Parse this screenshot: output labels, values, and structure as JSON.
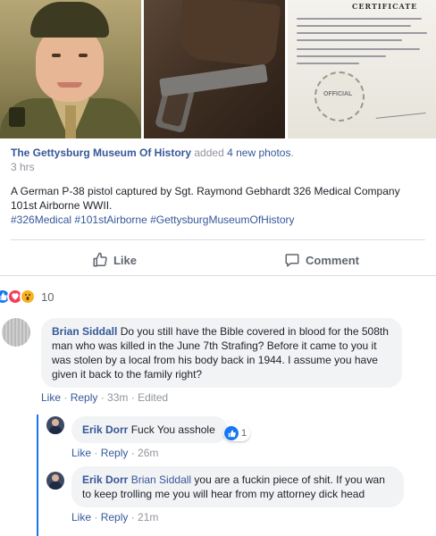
{
  "photos": {
    "certificate_title": "CERTIFICATE",
    "seal_label": "OFFICIAL"
  },
  "post": {
    "page_name": "The Gettysburg Museum Of History",
    "action_text": "added",
    "photo_count": "4 new photos",
    "period": ".",
    "time": "3 hrs",
    "body": "A German P-38 pistol captured by Sgt. Raymond Gebhardt 326 Medical Company 101st Airborne WWII.",
    "hashtags": "#326Medical #101stAirborne #GettysburgMuseumOfHistory"
  },
  "actions": {
    "like": "Like",
    "comment": "Comment"
  },
  "reactions": {
    "count": "10",
    "types": [
      "like",
      "love",
      "wow"
    ]
  },
  "comments": [
    {
      "author": "Brian Siddall",
      "text": "Do you still have the Bible covered in blood for the 508th man who was killed in the June 7th Strafing? Before it came to you it was stolen by a local from his body back in 1944. I assume you have given it back to the family right?",
      "like": "Like",
      "reply": "Reply",
      "time": "33m",
      "edited": "Edited"
    },
    {
      "author": "Erik Dorr",
      "text": "Fuck You asshole",
      "reaction_count": "1",
      "like": "Like",
      "reply": "Reply",
      "time": "26m"
    },
    {
      "author": "Erik Dorr",
      "mention": "Brian Siddall",
      "text": "you are a fuckin piece of shit. If you wan to keep trolling me you will hear from my attorney dick head",
      "like": "Like",
      "reply": "Reply",
      "time": "21m"
    }
  ],
  "colors": {
    "link": "#365899",
    "meta": "#90949c",
    "bubble": "#f2f3f5",
    "like_blue": "#1877f2",
    "love_red": "#f33e58",
    "wow_yellow": "#f7b125"
  }
}
